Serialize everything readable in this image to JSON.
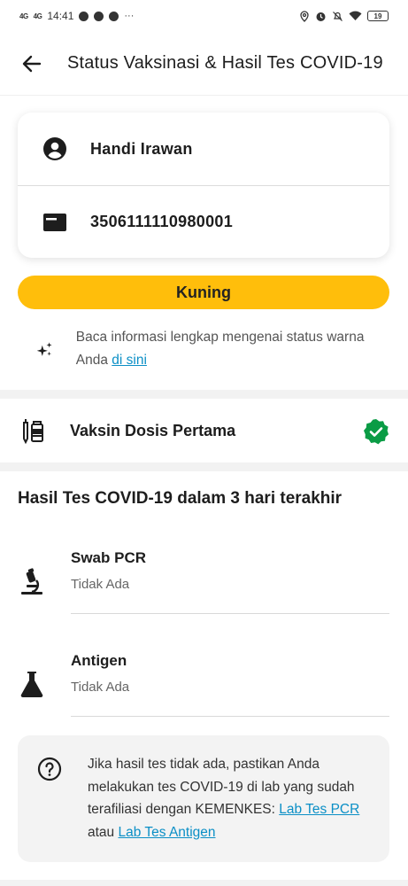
{
  "status_bar": {
    "signal1": "4G",
    "signal2": "4G",
    "time": "14:41",
    "more": "···",
    "battery": "19"
  },
  "header": {
    "title": "Status Vaksinasi & Hasil Tes COVID-19",
    "back_icon": "arrow-left-icon"
  },
  "identity": {
    "name": "Handi Irawan",
    "nik": "3506111110980001"
  },
  "status": {
    "label": "Kuning",
    "color": "#ffbe0b"
  },
  "info": {
    "text": "Baca informasi lengkap mengenai status warna Anda ",
    "link": "di sini"
  },
  "vaccine": {
    "label": "Vaksin Dosis Pertama",
    "badge_color": "#0a9c45"
  },
  "tests": {
    "title": "Hasil Tes COVID-19 dalam 3 hari terakhir",
    "items": [
      {
        "name": "Swab PCR",
        "status": "Tidak Ada"
      },
      {
        "name": "Antigen",
        "status": "Tidak Ada"
      }
    ]
  },
  "help": {
    "text": "Jika hasil tes tidak ada, pastikan Anda melakukan tes COVID-19 di lab yang sudah terafiliasi dengan KEMENKES: ",
    "link_pcr": "Lab Tes PCR",
    "conj": " atau ",
    "link_antigen": "Lab Tes Antigen"
  },
  "colors": {
    "link": "#0b8fc6",
    "divider": "#f2f2f2"
  }
}
